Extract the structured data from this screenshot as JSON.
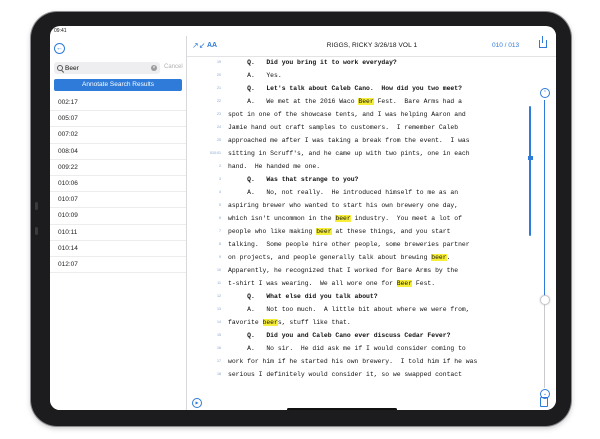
{
  "status": {
    "time": "09:41"
  },
  "search": {
    "value": "Beer",
    "placeholder": "",
    "cancel_label": "Cancel",
    "annotate_label": "Annotate Search Results"
  },
  "results": [
    "002:17",
    "005:07",
    "007:02",
    "008:04",
    "009:22",
    "010:06",
    "010:07",
    "010:09",
    "010:11",
    "010:14",
    "012:07"
  ],
  "header": {
    "title": "RIGGS, RICKY 3/26/18 VOL 1",
    "page_indicator": "010 / 013",
    "font_label": "AA"
  },
  "transcript": [
    {
      "n": "19",
      "bold": true,
      "t": "     Q.   Did you bring it to work everyday?"
    },
    {
      "n": "20",
      "bold": false,
      "t": "     A.   Yes."
    },
    {
      "n": "21",
      "bold": true,
      "t": "     Q.   Let's talk about Caleb Cano.  How did you two meet?"
    },
    {
      "n": "22",
      "bold": false,
      "t": "     A.   We met at the 2016 Waco [[Beer]] Fest.  Bare Arms had a"
    },
    {
      "n": "23",
      "bold": false,
      "t": "spot in one of the showcase tents, and I was helping Aaron and"
    },
    {
      "n": "24",
      "bold": false,
      "t": "Jamie hand out craft samples to customers.  I remember Caleb"
    },
    {
      "n": "25",
      "bold": false,
      "t": "approached me after I was taking a break from the event.  I was"
    },
    {
      "n": "010:01",
      "bold": false,
      "t": "sitting in Scruff's, and he came up with two pints, one in each"
    },
    {
      "n": "2",
      "bold": false,
      "t": "hand.  He handed me one."
    },
    {
      "n": "3",
      "bold": true,
      "t": "     Q.   Was that strange to you?"
    },
    {
      "n": "4",
      "bold": false,
      "t": "     A.   No, not really.  He introduced himself to me as an"
    },
    {
      "n": "5",
      "bold": false,
      "t": "aspiring brewer who wanted to start his own brewery one day,"
    },
    {
      "n": "6",
      "bold": false,
      "t": "which isn't uncommon in the [[beer]] industry.  You meet a lot of"
    },
    {
      "n": "7",
      "bold": false,
      "t": "people who like making [[beer]] at these things, and you start"
    },
    {
      "n": "8",
      "bold": false,
      "t": "talking.  Some people hire other people, some breweries partner"
    },
    {
      "n": "9",
      "bold": false,
      "t": "on projects, and people generally talk about brewing [[beer]]."
    },
    {
      "n": "10",
      "bold": false,
      "t": "Apparently, he recognized that I worked for Bare Arms by the"
    },
    {
      "n": "11",
      "bold": false,
      "t": "t-shirt I was wearing.  We all wore one for [[Beer]] Fest."
    },
    {
      "n": "12",
      "bold": true,
      "t": "     Q.   What else did you talk about?"
    },
    {
      "n": "13",
      "bold": false,
      "t": "     A.   Not too much.  A little bit about where we were from,"
    },
    {
      "n": "14",
      "bold": false,
      "t": "favorite [[beer]]s, stuff like that."
    },
    {
      "n": "15",
      "bold": true,
      "t": "     Q.   Did you and Caleb Cano ever discuss Cedar Fever?"
    },
    {
      "n": "16",
      "bold": false,
      "t": "     A.   No sir.  He did ask me if I would consider coming to"
    },
    {
      "n": "17",
      "bold": false,
      "t": "work for him if he started his own brewery.  I told him if he was"
    },
    {
      "n": "18",
      "bold": false,
      "t": "serious I definitely would consider it, so we swapped contact"
    }
  ],
  "scrubber": {
    "progress": 0.69
  },
  "colors": {
    "accent": "#2f7bd9",
    "highlight": "#f7ee3a"
  },
  "icons": {
    "back": "back-arrow-icon",
    "expand": "expand-arrows-icon",
    "share": "share-icon",
    "up": "chevron-up-icon",
    "down": "chevron-down-icon",
    "clear": "clear-icon",
    "doc": "document-icon"
  }
}
